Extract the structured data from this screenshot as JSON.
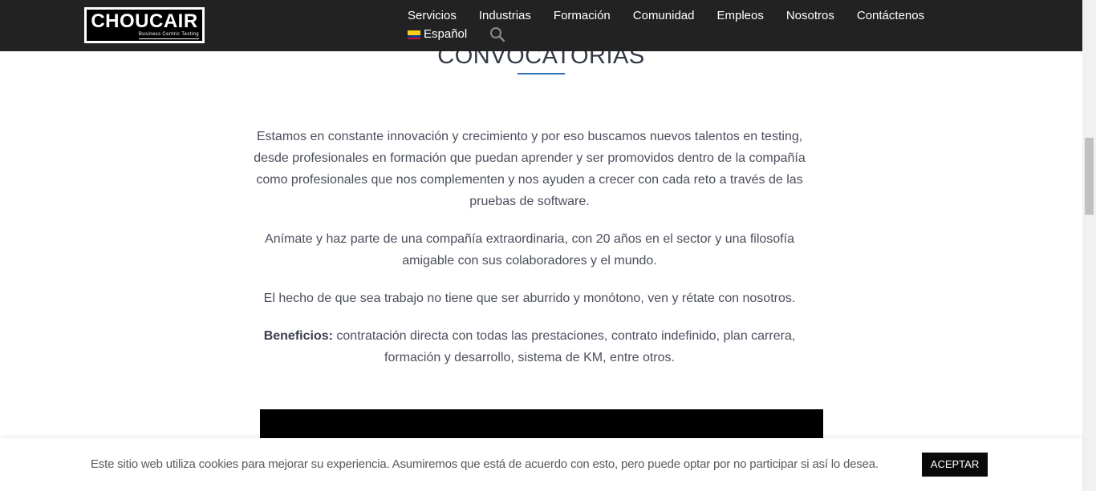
{
  "header": {
    "logo_text": "CHOUCAIR",
    "logo_tagline": "Business Centric Testing",
    "nav": [
      "Servicios",
      "Industrias",
      "Formación",
      "Comunidad",
      "Empleos",
      "Nosotros",
      "Contáctenos"
    ],
    "language": "Español",
    "flag_colors": [
      "#FCD116",
      "#003893",
      "#CE1126"
    ]
  },
  "main": {
    "title": "CONVOCATORIAS",
    "paragraph1": "Estamos en constante innovación y crecimiento y por eso buscamos nuevos talentos en testing, desde profesionales en formación que puedan aprender y ser promovidos dentro de la compañía como profesionales que nos complementen y nos ayuden a crecer con cada reto a través de las pruebas de software.",
    "paragraph2": "Anímate y haz parte de una compañía extraordinaria, con 20 años en el sector y una filosofía amigable con sus colaboradores y el mundo.",
    "paragraph3": "El hecho de que sea trabajo no tiene que ser aburrido y monótono, ven y rétate con nosotros.",
    "benefits_label": "Beneficios:",
    "benefits_text": " contratación directa con todas las prestaciones, contrato indefinido,  plan carrera, formación y desarrollo, sistema de KM, entre otros."
  },
  "cookie": {
    "text": "Este sitio web utiliza cookies para mejorar su experiencia. Asumiremos que está de acuerdo con esto, pero puede optar por no participar si así lo desea.",
    "button": "ACEPTAR"
  },
  "colors": {
    "header_bg": "#222222",
    "accent_underline": "#2c6fb3"
  }
}
